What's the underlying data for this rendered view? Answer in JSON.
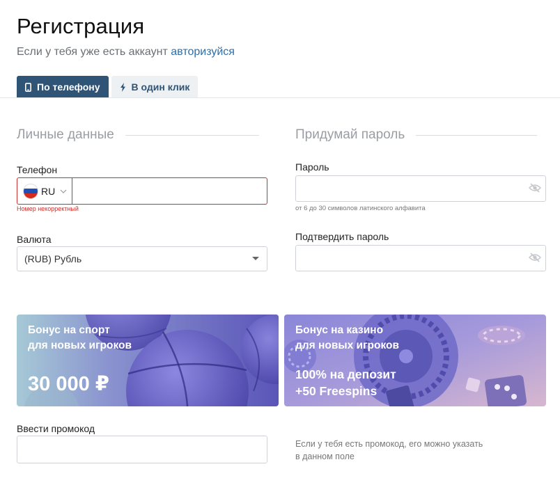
{
  "header": {
    "title": "Регистрация",
    "subtitle": "Если у тебя уже есть аккаунт",
    "login_link": "авторизуйся"
  },
  "tabs": [
    {
      "label": "По телефону",
      "icon": "phone-icon",
      "active": true
    },
    {
      "label": "В один клик",
      "icon": "lightning-icon",
      "active": false
    }
  ],
  "personal": {
    "heading": "Личные данные",
    "phone_label": "Телефон",
    "country_code": "RU",
    "phone_value": "",
    "phone_error": "Номер некорректный",
    "currency_label": "Валюта",
    "currency_value": "(RUB) Рубль"
  },
  "password": {
    "heading": "Придумай пароль",
    "password_label": "Пароль",
    "password_hint": "от 6 до 30 символов латинского алфавита",
    "confirm_label": "Подтвердить пароль"
  },
  "banners": {
    "sport": {
      "title_line1": "Бонус на спорт",
      "title_line2": "для новых игроков",
      "amount": "30 000 ₽"
    },
    "casino": {
      "title_line1": "Бонус на казино",
      "title_line2": "для новых игроков",
      "offer_line1": "100% на депозит",
      "offer_line2": "+50 Freespins"
    }
  },
  "promo": {
    "label": "Ввести промокод",
    "value": "",
    "hint_line1": "Если у тебя есть промокод, его можно указать",
    "hint_line2": "в данном поле"
  },
  "colors": {
    "accent": "#2f5476",
    "link": "#2f6ea8",
    "error": "#c9302c"
  }
}
